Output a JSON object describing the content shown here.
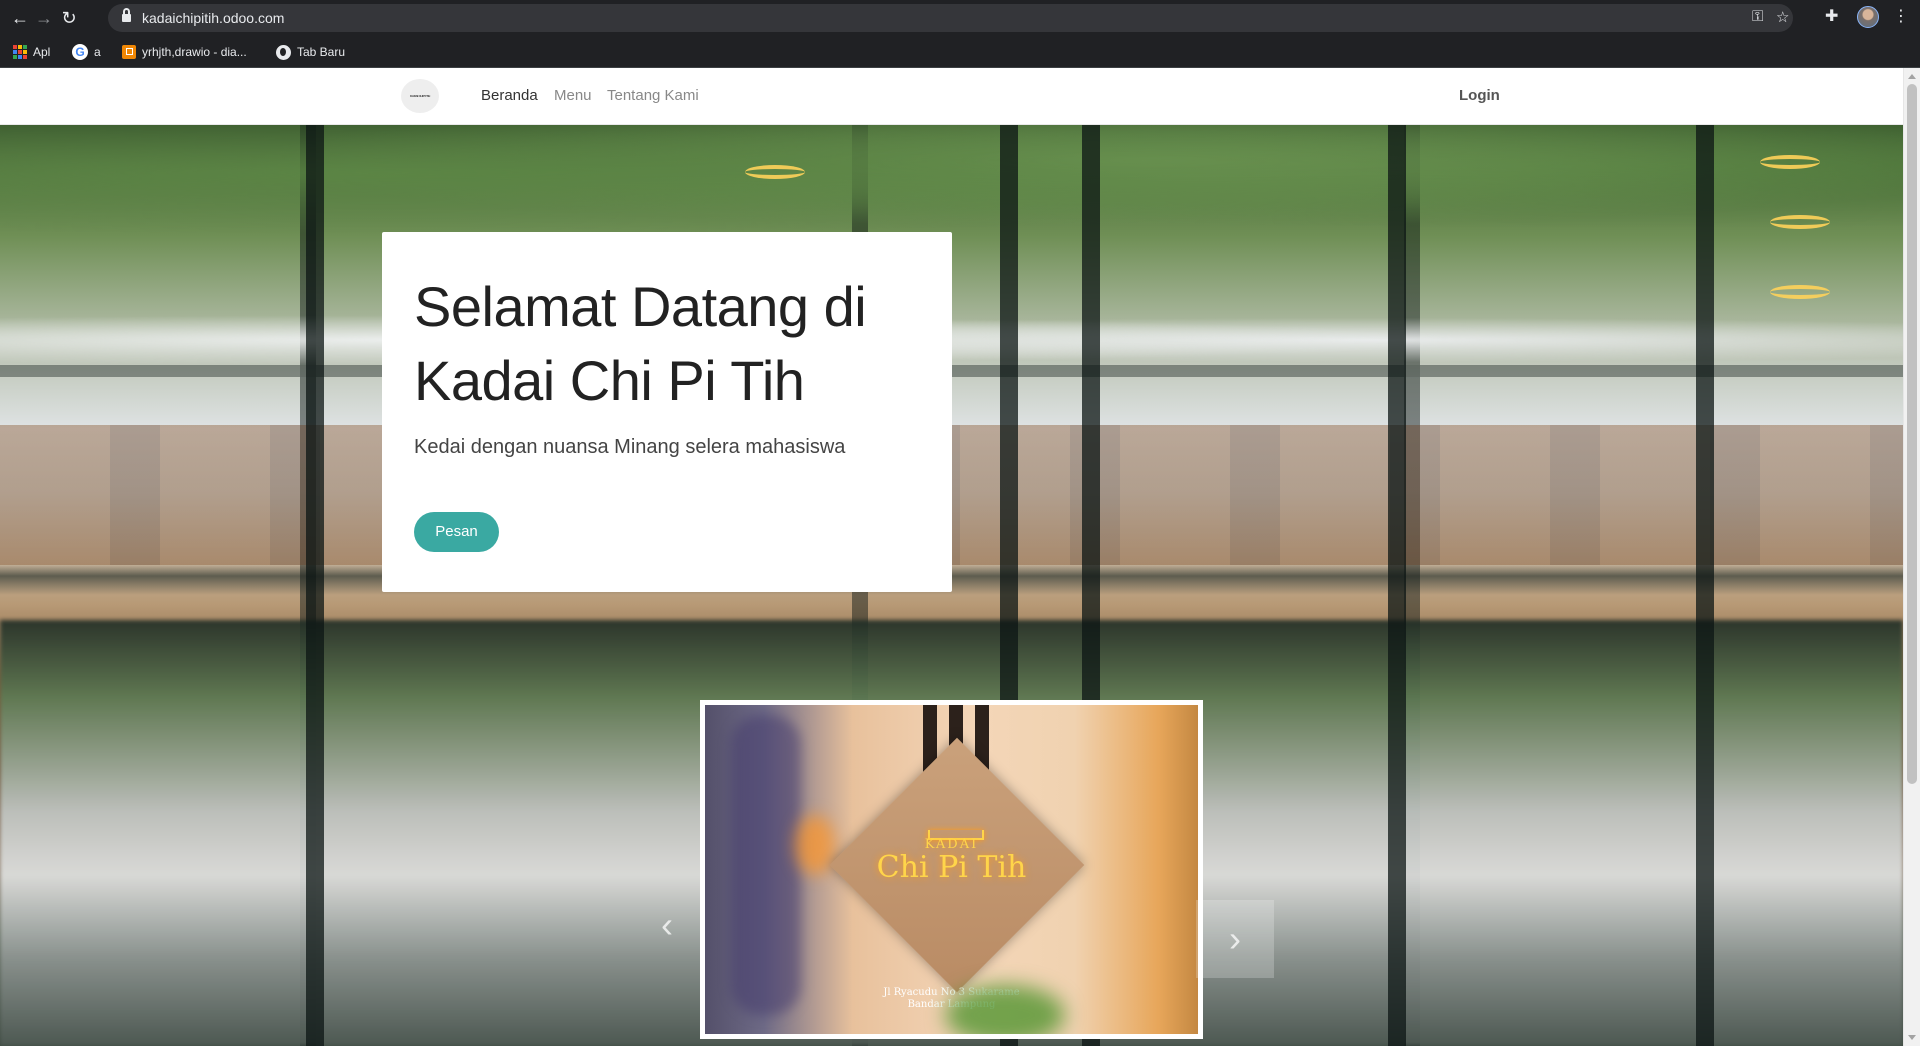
{
  "browser": {
    "url": "kadaichipitih.odoo.com",
    "bookmarks": [
      {
        "label": "Apl",
        "icon": "apps-grid-icon"
      },
      {
        "label": "a",
        "icon": "google-icon"
      },
      {
        "label": "yrhjth,drawio - dia...",
        "icon": "drawio-icon"
      },
      {
        "label": "Tab Baru",
        "icon": "globe-icon"
      }
    ]
  },
  "site": {
    "logo_text": "KADAI CHI PI TIH",
    "nav": {
      "home": "Beranda",
      "menu": "Menu",
      "about": "Tentang Kami"
    },
    "login": "Login"
  },
  "hero": {
    "title": "Selamat Datang di Kadai Chi Pi Tih",
    "subtitle": "Kedai dengan nuansa Minang selera mahasiswa",
    "cta": "Pesan"
  },
  "carousel": {
    "sign_top": "KADAI",
    "sign_main": "Chi Pi Tih",
    "address_line1": "Jl Ryacudu No 3 Sukarame",
    "address_line2": "Bandar Lampung",
    "prev": "‹",
    "next": "›"
  },
  "colors": {
    "accent": "#3aa9a2",
    "chrome_bg": "#202124"
  }
}
